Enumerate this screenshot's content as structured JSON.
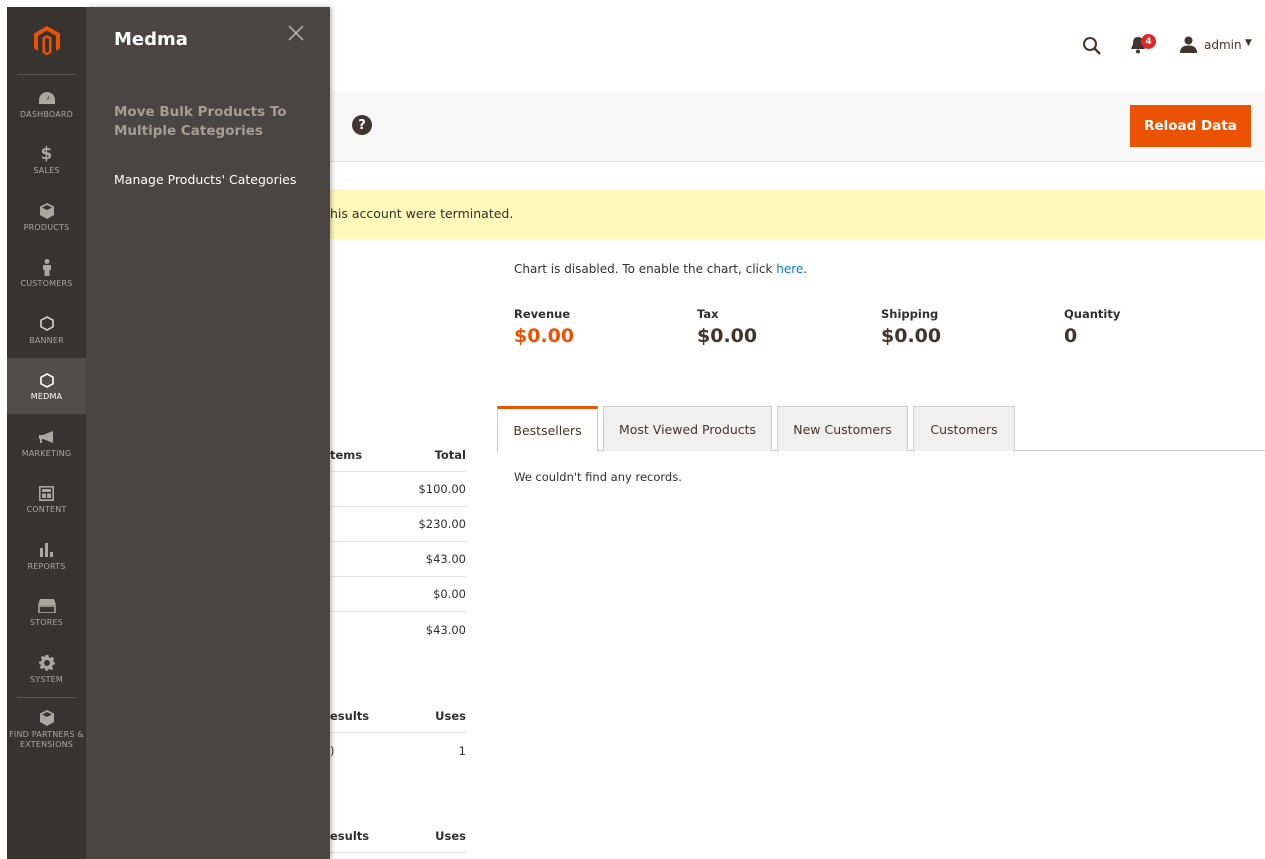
{
  "nav": {
    "items": [
      {
        "label": "DASHBOARD",
        "icon": "dashboard-icon"
      },
      {
        "label": "SALES",
        "icon": "dollar-icon"
      },
      {
        "label": "PRODUCTS",
        "icon": "box-icon"
      },
      {
        "label": "CUSTOMERS",
        "icon": "person-icon"
      },
      {
        "label": "BANNER",
        "icon": "hexagon-icon"
      },
      {
        "label": "MEDMA",
        "icon": "hexagon-icon"
      },
      {
        "label": "MARKETING",
        "icon": "megaphone-icon"
      },
      {
        "label": "CONTENT",
        "icon": "layout-icon"
      },
      {
        "label": "REPORTS",
        "icon": "bar-chart-icon"
      },
      {
        "label": "STORES",
        "icon": "store-icon"
      },
      {
        "label": "SYSTEM",
        "icon": "gear-icon"
      }
    ],
    "extensions_label": "FIND PARTNERS & EXTENSIONS"
  },
  "flyout": {
    "title": "Medma",
    "group_title": "Move Bulk Products To Multiple Categories",
    "link": "Manage Products' Categories"
  },
  "header": {
    "notifications_count": "4",
    "user": "admin"
  },
  "actions": {
    "reload_label": "Reload Data"
  },
  "message": {
    "text": "his account were terminated."
  },
  "last_orders": {
    "col_items": "tems",
    "col_total": "Total",
    "totals": [
      "$100.00",
      "$230.00",
      "$43.00",
      "$0.00",
      "$43.00"
    ]
  },
  "last_search": {
    "col_results": "esults",
    "col_uses": "Uses",
    "rows": [
      {
        "results": ")",
        "uses": "1"
      }
    ]
  },
  "top_search": {
    "col_results": "esults",
    "col_uses": "Uses"
  },
  "chart": {
    "message": "Chart is disabled. To enable the chart, click ",
    "link": "here",
    "period": "."
  },
  "totals": [
    {
      "label": "Revenue",
      "value": "$0.00"
    },
    {
      "label": "Tax",
      "value": "$0.00"
    },
    {
      "label": "Shipping",
      "value": "$0.00"
    },
    {
      "label": "Quantity",
      "value": "0"
    }
  ],
  "tabs": [
    "Bestsellers",
    "Most Viewed Products",
    "New Customers",
    "Customers"
  ],
  "grid": {
    "empty": "We couldn't find any records."
  },
  "colors": {
    "accent": "#eb5202",
    "nav_bg": "#373330",
    "flyout_bg": "#4a4542",
    "message_bg": "#fffbbb",
    "link": "#007bdb"
  }
}
